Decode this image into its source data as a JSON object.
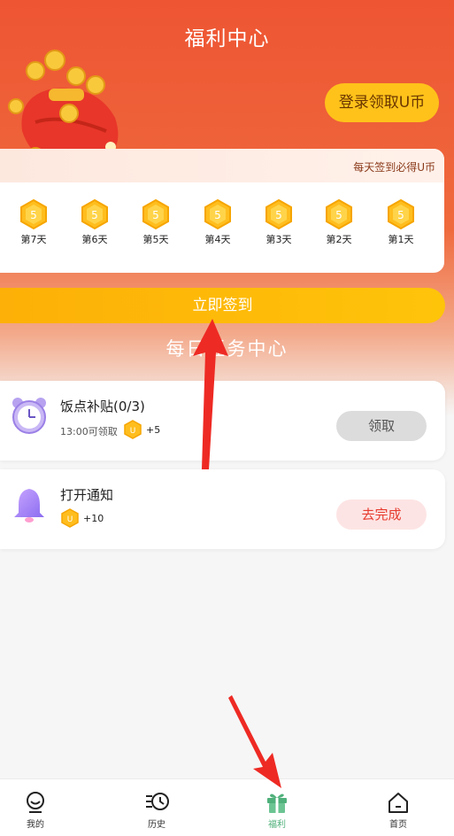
{
  "header": {
    "title": "福利中心",
    "login_label": "登录领取U币"
  },
  "signin": {
    "banner_text": "每天签到必得U币",
    "days": [
      {
        "label": "第7天",
        "coins": "5"
      },
      {
        "label": "第6天",
        "coins": "5"
      },
      {
        "label": "第5天",
        "coins": "5"
      },
      {
        "label": "第4天",
        "coins": "5"
      },
      {
        "label": "第3天",
        "coins": "5"
      },
      {
        "label": "第2天",
        "coins": "5"
      },
      {
        "label": "第1天",
        "coins": "5"
      }
    ],
    "button_label": "立即签到"
  },
  "tasks": {
    "title": "每日任务中心",
    "items": [
      {
        "title": "饭点补贴(0/3)",
        "subtitle": "13:00可领取",
        "reward": "+5",
        "button": "领取"
      },
      {
        "title": "打开通知",
        "reward": "+10",
        "button": "去完成"
      }
    ]
  },
  "nav": {
    "items": [
      {
        "label": "我的",
        "icon": "profile-icon"
      },
      {
        "label": "历史",
        "icon": "history-icon"
      },
      {
        "label": "福利",
        "icon": "gift-icon"
      },
      {
        "label": "首页",
        "icon": "home-icon"
      }
    ],
    "active": "福利"
  },
  "colors": {
    "header_gradient_top": "#ee5533",
    "accent_yellow": "#ffc21a",
    "active_nav": "#4fb07a",
    "arrow_red": "#ee2a24"
  }
}
